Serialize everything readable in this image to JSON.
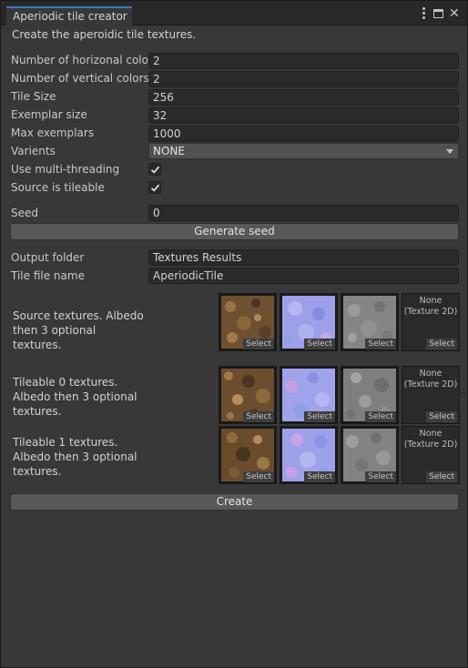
{
  "window": {
    "tab_title": "Aperiodic tile creator"
  },
  "description": "Create the aperoidic tile textures.",
  "fields": {
    "horiz_label": "Number of horizonal colors",
    "horiz_value": "2",
    "vert_label": "Number of vertical colors",
    "vert_value": "2",
    "tile_size_label": "Tile Size",
    "tile_size_value": "256",
    "exemplar_label": "Exemplar size",
    "exemplar_value": "32",
    "max_ex_label": "Max exemplars",
    "max_ex_value": "1000",
    "varients_label": "Varients",
    "varients_value": "NONE",
    "multithread_label": "Use multi-threading",
    "multithread_checked": true,
    "tileable_label": "Source is tileable",
    "tileable_checked": true,
    "seed_label": "Seed",
    "seed_value": "0",
    "output_label": "Output folder",
    "output_value": "Textures Results",
    "tilename_label": "Tile file name",
    "tilename_value": "AperiodicTile"
  },
  "buttons": {
    "generate_seed": "Generate seed",
    "create": "Create"
  },
  "texture_rows": [
    {
      "label": "Source textures. Albedo then 3 optional textures."
    },
    {
      "label": "Tileable 0 textures. Albedo then 3 optional textures."
    },
    {
      "label": "Tileable 1 textures. Albedo then 3 optional textures."
    }
  ],
  "slot": {
    "select": "Select",
    "none_line1": "None",
    "none_line2": "(Texture 2D)"
  },
  "colors": {
    "albedo": "#7a5a33",
    "normal": "#9a9ae6",
    "gray": "#8a8a8a",
    "accent": "#3a79bb"
  }
}
